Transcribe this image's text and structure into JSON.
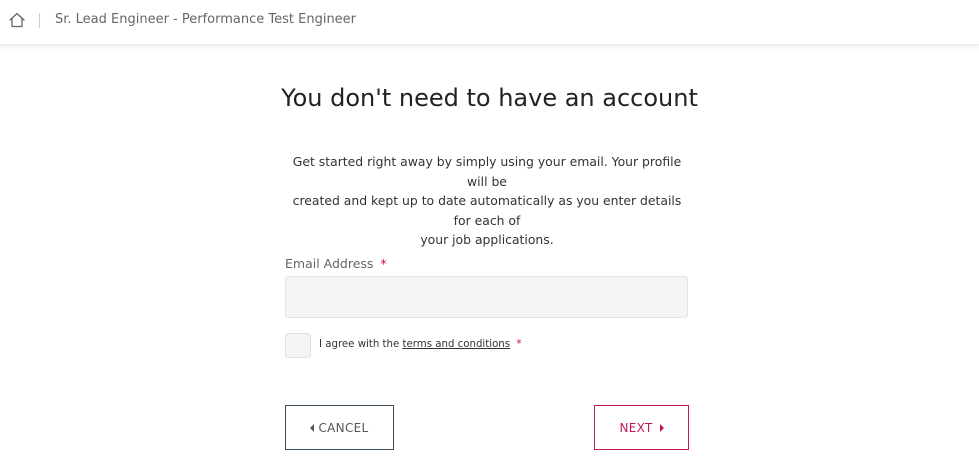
{
  "header": {
    "home_icon": "home-icon",
    "breadcrumb": "Sr. Lead Engineer - Performance Test Engineer"
  },
  "main": {
    "title": "You don't need to have an account",
    "intro_line1": "Get started right away by simply using your email. Your profile will be",
    "intro_line2": "created and kept up to date automatically as you enter details for each of",
    "intro_line3": "your job applications."
  },
  "form": {
    "email_label": "Email Address",
    "required_marker": "*",
    "email_value": "",
    "email_placeholder": "",
    "agree_prefix": "I agree with the",
    "terms_link": "terms and conditions",
    "agree_required_marker": "*",
    "agree_checked": false
  },
  "actions": {
    "cancel_label": "CANCEL",
    "next_label": "NEXT"
  },
  "colors": {
    "accent": "#c2185b",
    "cancel_border": "#3c4e5e",
    "input_background": "#f4f4f4"
  }
}
